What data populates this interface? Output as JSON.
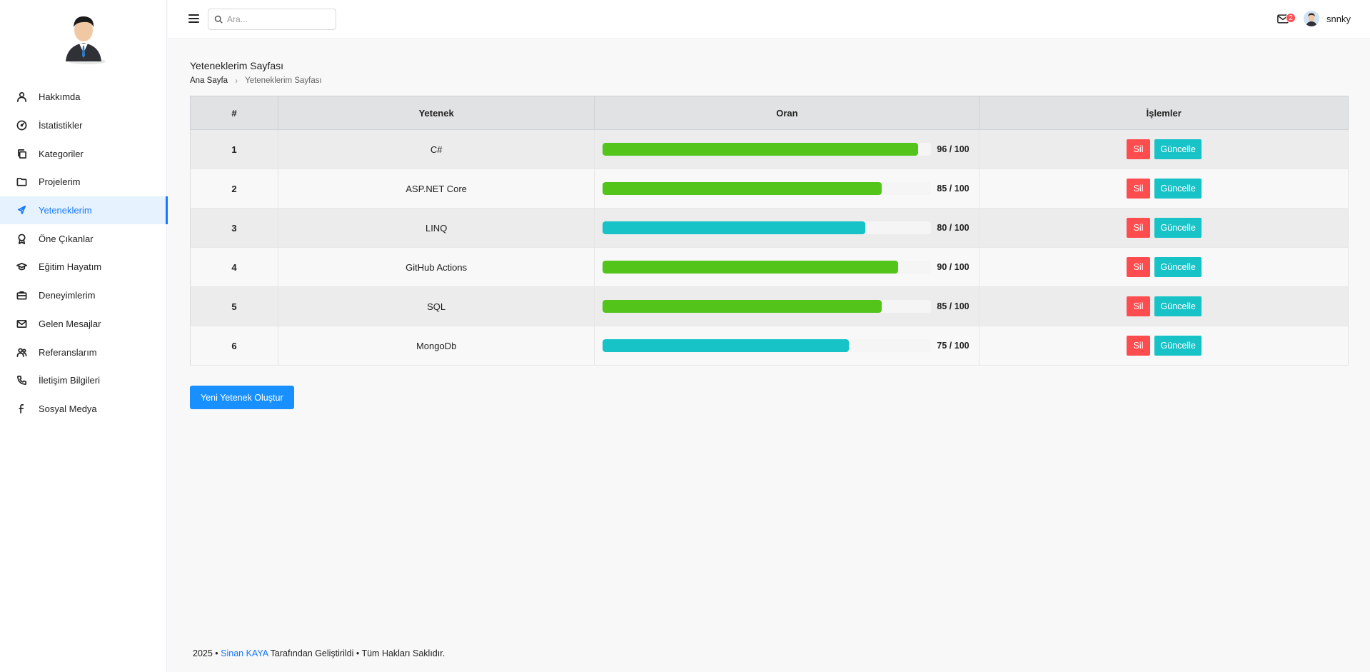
{
  "sidebar": {
    "items": [
      {
        "label": "Hakkımda",
        "icon": "user-icon"
      },
      {
        "label": "İstatistikler",
        "icon": "dashboard-icon"
      },
      {
        "label": "Kategoriler",
        "icon": "copy-icon"
      },
      {
        "label": "Projelerim",
        "icon": "folder-icon"
      },
      {
        "label": "Yeteneklerim",
        "icon": "send-icon",
        "active": true
      },
      {
        "label": "Öne Çıkanlar",
        "icon": "trophy-icon"
      },
      {
        "label": "Eğitim Hayatım",
        "icon": "graduation-cap-icon"
      },
      {
        "label": "Deneyimlerim",
        "icon": "briefcase-icon"
      },
      {
        "label": "Gelen Mesajlar",
        "icon": "mail-icon"
      },
      {
        "label": "Referanslarım",
        "icon": "team-icon"
      },
      {
        "label": "İletişim Bilgileri",
        "icon": "phone-icon"
      },
      {
        "label": "Sosyal Medya",
        "icon": "facebook-icon"
      }
    ]
  },
  "header": {
    "search_placeholder": "Ara...",
    "mail_count": "2",
    "username": "snnky"
  },
  "page": {
    "title": "Yeteneklerim Sayfası",
    "breadcrumb_home": "Ana Sayfa",
    "breadcrumb_current": "Yeteneklerim Sayfası"
  },
  "table": {
    "headers": {
      "num": "#",
      "skill": "Yetenek",
      "rate": "Oran",
      "ops": "İşlemler"
    },
    "rows": [
      {
        "num": "1",
        "skill": "C#",
        "value": 96,
        "rate_text": "96 / 100",
        "color": "#52c41a"
      },
      {
        "num": "2",
        "skill": "ASP.NET Core",
        "value": 85,
        "rate_text": "85 / 100",
        "color": "#52c41a"
      },
      {
        "num": "3",
        "skill": "LINQ",
        "value": 80,
        "rate_text": "80 / 100",
        "color": "#17c3c7"
      },
      {
        "num": "4",
        "skill": "GitHub Actions",
        "value": 90,
        "rate_text": "90 / 100",
        "color": "#52c41a"
      },
      {
        "num": "5",
        "skill": "SQL",
        "value": 85,
        "rate_text": "85 / 100",
        "color": "#52c41a"
      },
      {
        "num": "6",
        "skill": "MongoDb",
        "value": 75,
        "rate_text": "75 / 100",
        "color": "#17c3c7"
      }
    ],
    "delete_label": "Sil",
    "update_label": "Güncelle"
  },
  "actions": {
    "new_skill_label": "Yeni Yetenek Oluştur"
  },
  "footer": {
    "year": "2025 •",
    "author": "Sinan KAYA",
    "rest": "Tarafından Geliştirildi • Tüm Hakları Saklıdır."
  }
}
